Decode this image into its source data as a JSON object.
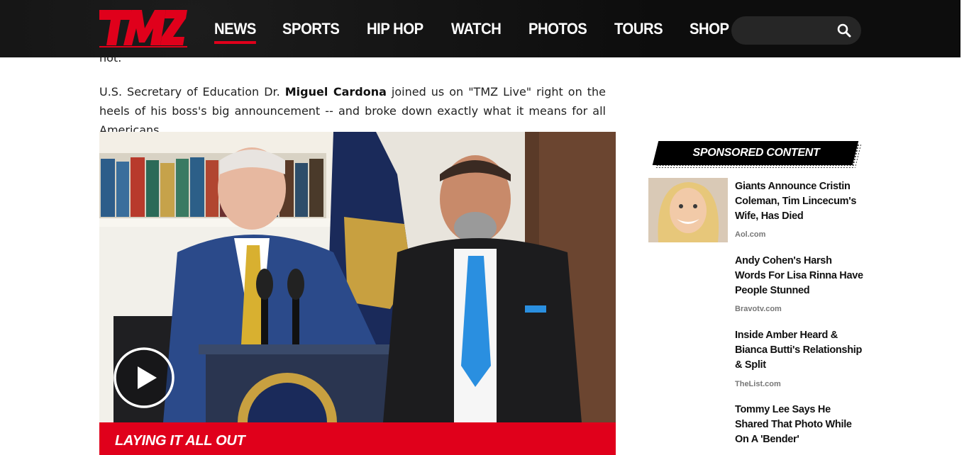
{
  "header": {
    "logo_text": "TMZ",
    "nav": [
      {
        "label": "NEWS",
        "active": true
      },
      {
        "label": "SPORTS",
        "active": false
      },
      {
        "label": "HIP HOP",
        "active": false
      },
      {
        "label": "WATCH",
        "active": false
      },
      {
        "label": "PHOTOS",
        "active": false
      },
      {
        "label": "TOURS",
        "active": false
      },
      {
        "label": "SHOP",
        "active": false
      }
    ],
    "search": {
      "placeholder": "",
      "value": "",
      "icon": "search-icon"
    }
  },
  "article": {
    "fragment": "not.",
    "paragraph": {
      "before": "U.S. Secretary of Education Dr. ",
      "bold": "Miguel Cardona",
      "after": " joined us on \"TMZ Live\" right on the heels of his boss's big announcement -- and broke down exactly what it means for all Americans."
    },
    "video": {
      "caption": "LAYING IT ALL OUT",
      "play_icon": "play-icon"
    }
  },
  "sidebar": {
    "heading": "SPONSORED CONTENT",
    "items": [
      {
        "title": "Giants Announce Cristin Coleman, Tim Lincecum's Wife, Has Died",
        "source": "Aol.com"
      },
      {
        "title": "Andy Cohen's Harsh Words For Lisa Rinna Have People Stunned",
        "source": "Bravotv.com"
      },
      {
        "title": "Inside Amber Heard & Bianca Butti's Relationship & Split",
        "source": "TheList.com"
      },
      {
        "title": "Tommy Lee Says He Shared That Photo While On A 'Bender'",
        "source": ""
      }
    ]
  },
  "colors": {
    "brand_red": "#e0001b",
    "header_bg": "#0d0d0d"
  }
}
